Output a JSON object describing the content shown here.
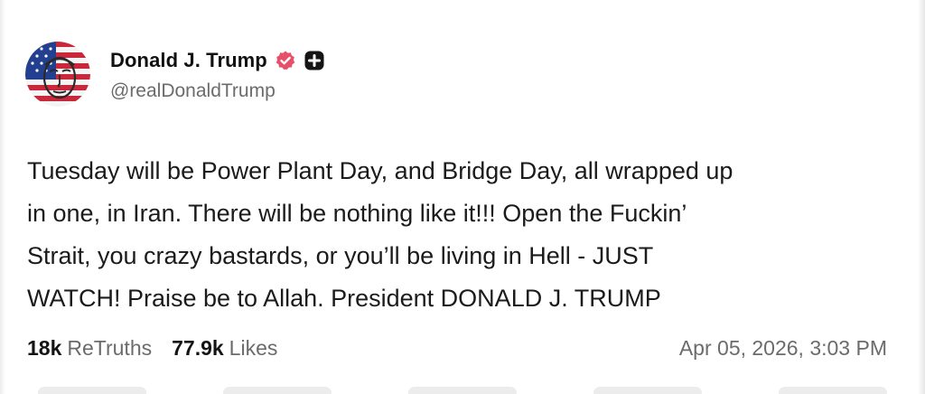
{
  "post": {
    "author": {
      "display_name": "Donald J. Trump",
      "handle": "@realDonaldTrump",
      "avatar_icon": "flag-face-avatar",
      "verified_icon": "verified-badge-icon",
      "verified_color": "#e8506a",
      "extra_icon": "plus-badge-icon"
    },
    "text": "Tuesday will be Power Plant Day, and Bridge Day, all wrapped up\nin one, in Iran. There will be nothing like it!!! Open the Fuckin’\nStrait, you crazy bastards, or you’ll be living in Hell - JUST\nWATCH! Praise be to Allah. President DONALD J. TRUMP",
    "stats": {
      "retruths_count": "18k",
      "retruths_label": "ReTruths",
      "likes_count": "77.9k",
      "likes_label": "Likes"
    },
    "timestamp": "Apr 05, 2026, 3:03 PM"
  }
}
